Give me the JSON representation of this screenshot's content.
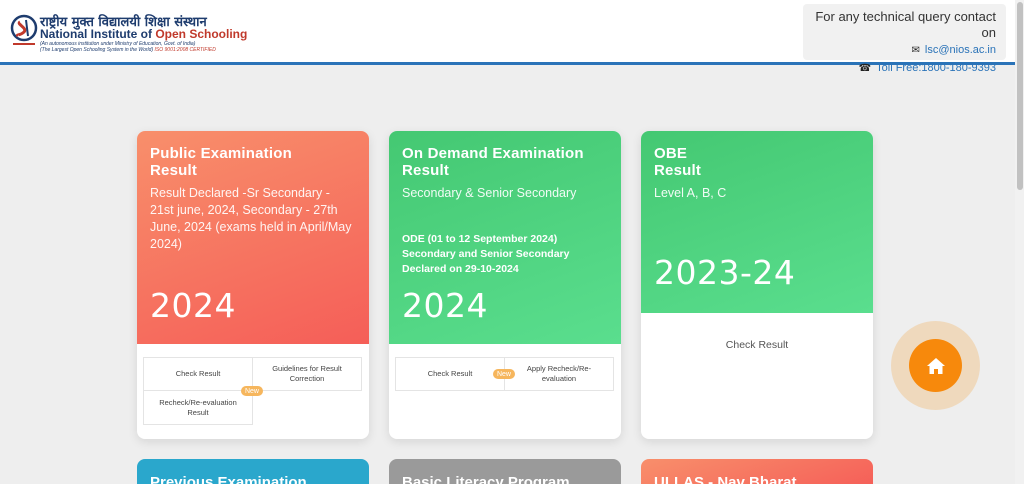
{
  "header": {
    "logo": {
      "hindi": "राष्ट्रीय मुक्त विद्यालयी शिक्षा संस्थान",
      "english_1": "National Institute of",
      "english_2": "Open Schooling",
      "sub_1": "(An autonomous institution under Ministry of Education, Govt. of India)",
      "sub_2": "(The Largest Open Schooling System in the World)",
      "sub_iso": "ISO 9001:2008 CERTIFIED"
    },
    "contact": {
      "title": "For any technical query contact on",
      "email": "lsc@nios.ac.in",
      "phone": "Toll Free:1800-180-9393",
      "email_icon": "envelope-icon",
      "phone_icon": "phone-icon"
    }
  },
  "cards": [
    {
      "title_1": "Public Examination",
      "title_2": "Result",
      "subtitle": "Result Declared -Sr Secondary - 21st june, 2024, Secondary - 27th June, 2024 (exams held in April/May 2024)",
      "year": "2024",
      "color_from": "#f88f6b",
      "color_to": "#f55e58",
      "links": [
        "Check Result",
        "Guidelines for Result Correction",
        "Recheck/Re-evaluation Result"
      ],
      "badge": "New"
    },
    {
      "title_1": "On Demand Examination",
      "title_2": "Result",
      "subtitle": "Secondary & Senior Secondary",
      "note": "ODE (01 to 12 September 2024) Secondary and Senior Secondary Declared on 29-10-2024",
      "year": "2024",
      "color_from": "#44c872",
      "color_to": "#5ade8e",
      "links": [
        "Check Result",
        "Apply Recheck/Re-evaluation"
      ],
      "badge": "New"
    },
    {
      "title_1": "OBE",
      "title_2": "Result",
      "subtitle": "Level A, B, C",
      "year": "2023-24",
      "color_from": "#44c872",
      "color_to": "#5ade8e",
      "links": [
        "Check Result"
      ]
    }
  ],
  "bottom_cards": [
    {
      "title": "Previous Examination",
      "color": "#2aa7cc"
    },
    {
      "title": "Basic Literacy Program",
      "color": "#9a9a9a"
    },
    {
      "title": "ULLAS - Nav Bharat",
      "color": "#f6755b"
    }
  ],
  "home_button": {
    "icon": "home-icon",
    "color": "#f7890c"
  }
}
